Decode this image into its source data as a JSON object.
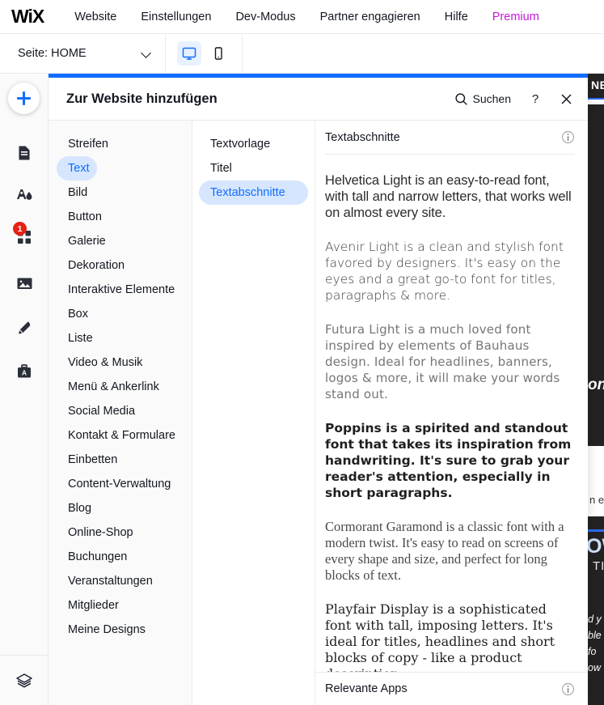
{
  "topnav": {
    "logo": "WiX",
    "items": [
      {
        "label": "Website"
      },
      {
        "label": "Einstellungen"
      },
      {
        "label": "Dev-Modus"
      },
      {
        "label": "Partner engagieren"
      },
      {
        "label": "Hilfe"
      },
      {
        "label": "Premium"
      }
    ]
  },
  "toolbar": {
    "page_label": "Seite:",
    "page_value": "HOME",
    "desktop_icon": "desktop-icon",
    "mobile_icon": "mobile-icon"
  },
  "rail": {
    "add_icon": "plus-icon",
    "items": [
      {
        "icon": "pages-icon",
        "badge": ""
      },
      {
        "icon": "theme-icon",
        "badge": ""
      },
      {
        "icon": "apps-grid-icon",
        "badge": "1"
      },
      {
        "icon": "media-icon",
        "badge": ""
      },
      {
        "icon": "blog-pen-icon",
        "badge": ""
      },
      {
        "icon": "business-tools-icon",
        "badge": ""
      }
    ],
    "bottom_icon": "layers-icon"
  },
  "panel": {
    "title": "Zur Website hinzufügen",
    "search_label": "Suchen",
    "search_icon": "search-icon",
    "help_icon": "question-mark-icon",
    "close_icon": "close-icon",
    "accent_color": "#116DFF",
    "selected_pill_bg": "#D6E6FE",
    "selected_pill_text": "#116DFF",
    "categories": [
      {
        "label": "Streifen",
        "selected": false
      },
      {
        "label": "Text",
        "selected": true
      },
      {
        "label": "Bild",
        "selected": false
      },
      {
        "label": "Button",
        "selected": false
      },
      {
        "label": "Galerie",
        "selected": false
      },
      {
        "label": "Dekoration",
        "selected": false
      },
      {
        "label": "Interaktive Elemente",
        "selected": false
      },
      {
        "label": "Box",
        "selected": false
      },
      {
        "label": "Liste",
        "selected": false
      },
      {
        "label": "Video & Musik",
        "selected": false
      },
      {
        "label": "Menü & Ankerlink",
        "selected": false
      },
      {
        "label": "Social Media",
        "selected": false
      },
      {
        "label": "Kontakt & Formulare",
        "selected": false
      },
      {
        "label": "Einbetten",
        "selected": false
      },
      {
        "label": "Content-Verwaltung",
        "selected": false
      },
      {
        "label": "Blog",
        "selected": false
      },
      {
        "label": "Online-Shop",
        "selected": false
      },
      {
        "label": "Buchungen",
        "selected": false
      },
      {
        "label": "Veranstaltungen",
        "selected": false
      },
      {
        "label": "Mitglieder",
        "selected": false
      },
      {
        "label": "Meine Designs",
        "selected": false
      }
    ],
    "subcategories": [
      {
        "label": "Textvorlage",
        "selected": false
      },
      {
        "label": "Titel",
        "selected": false
      },
      {
        "label": "Textabschnitte",
        "selected": true
      }
    ],
    "section": {
      "title": "Textabschnitte",
      "info_icon": "info-icon"
    },
    "samples": [
      {
        "style": "s-helv",
        "text": "Helvetica Light is an easy-to-read font, with tall and narrow letters, that works well on almost every site."
      },
      {
        "style": "s-avenir",
        "text": "Avenir Light is a clean and stylish font favored by designers. It's easy on the eyes and a great go-to font for titles, paragraphs & more."
      },
      {
        "style": "s-futura",
        "text": "Futura Light is a much loved font inspired by elements of Bauhaus design. Ideal for headlines, banners, logos & more, it will make your words stand out."
      },
      {
        "style": "s-poppins",
        "text": "Poppins is a spirited and standout font that takes its inspiration from handwriting. It's sure to grab your reader's attention, especially in short paragraphs."
      },
      {
        "style": "s-cormorant",
        "text": "Cormorant Garamond is a classic font with a modern twist. It's easy to read on screens of every shape and size, and perfect for long blocks of text."
      },
      {
        "style": "s-playfair",
        "text": "Playfair Display is a sophisticated font with tall, imposing letters. It's ideal for titles, headlines and short blocks of copy - like a product description."
      }
    ],
    "apps_bar": {
      "title": "Relevante Apps",
      "info_icon": "info-icon"
    }
  },
  "preview": {
    "fragment_ne": "NE",
    "fragment_on": "on",
    "fragment_ne2": "n e",
    "fragment_ow": "OW",
    "fragment_tiv": "TIV",
    "fragment_lines": [
      "d y",
      "ble",
      "fo",
      "ow"
    ]
  }
}
